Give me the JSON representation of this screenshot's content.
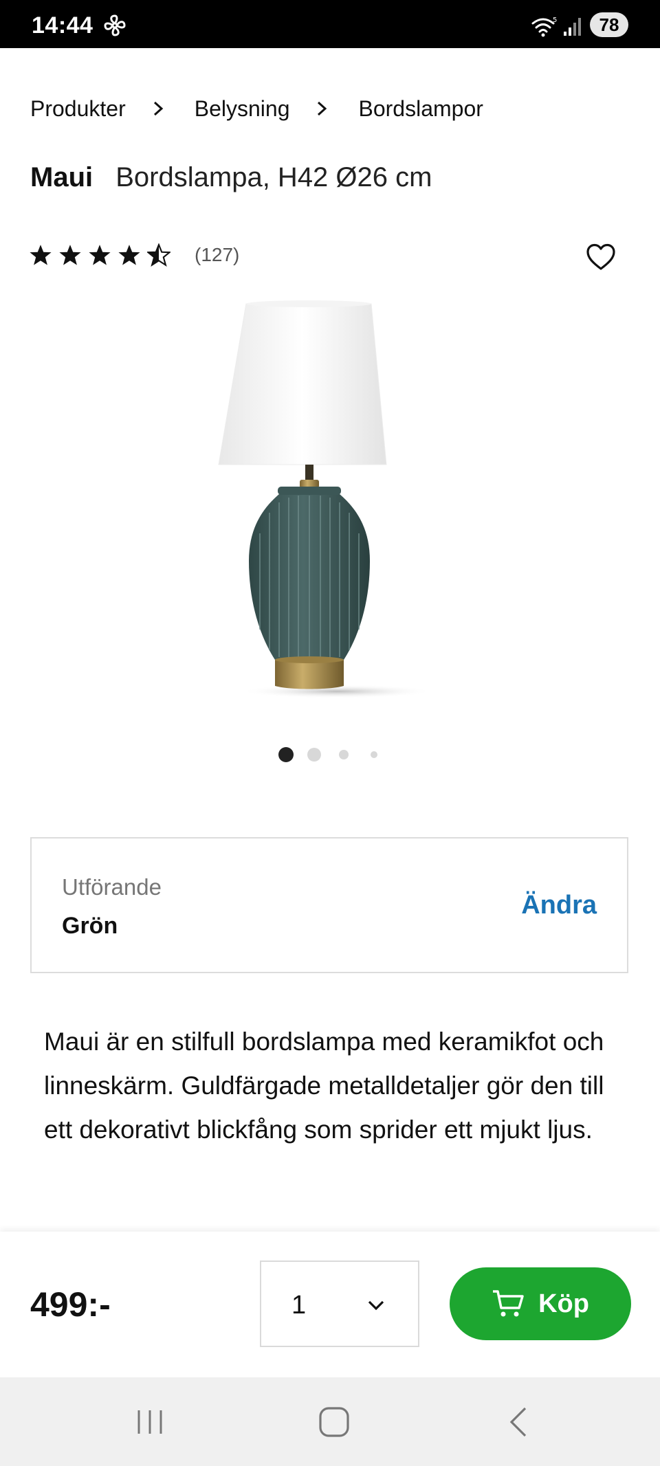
{
  "status_bar": {
    "time": "14:44",
    "battery": "78",
    "icons": [
      "fan-icon",
      "wifi-icon",
      "signal-icon"
    ]
  },
  "breadcrumb": {
    "items": [
      "Produkter",
      "Belysning",
      "Bordslampor"
    ]
  },
  "product": {
    "brand": "Maui",
    "description": "Bordslampa, H42 Ø26 cm",
    "rating_value": 4.5,
    "rating_max": 5,
    "review_count": "(127)",
    "image_count": 4,
    "current_image": 1
  },
  "variant": {
    "label": "Utförande",
    "value": "Grön",
    "change_label": "Ändra"
  },
  "body_text": "Maui är en stilfull bordslampa med keramikfot och linneskärm. Guldfärgade metalldetaljer gör den till ett dekorativt blickfång som sprider ett mjukt ljus.",
  "purchase": {
    "price": "499:-",
    "quantity": "1",
    "buy_label": "Köp"
  },
  "colors": {
    "accent_link": "#1a73b5",
    "buy_button": "#1da630",
    "lamp_base": "#3f5b5a",
    "brass": "#b0944f"
  }
}
